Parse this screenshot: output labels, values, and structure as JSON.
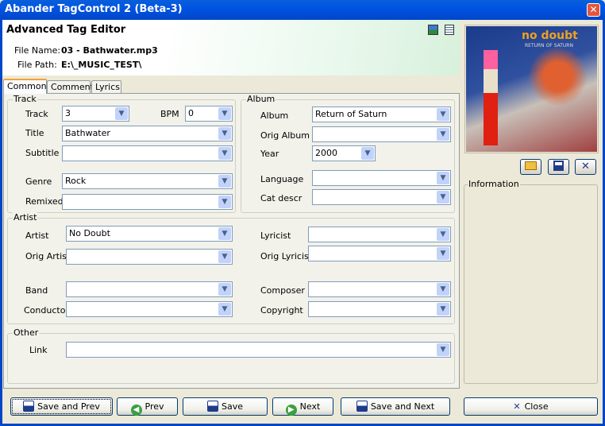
{
  "window": {
    "title": "Abander TagControl 2 (Beta-3)",
    "close": "✕"
  },
  "header": {
    "title": "Advanced Tag Editor",
    "file_name_label": "File Name:",
    "file_name": "03 - Bathwater.mp3",
    "file_path_label": "File Path:",
    "file_path": "E:\\_MUSIC_TEST\\"
  },
  "tabs": [
    {
      "label": "Common",
      "active": true
    },
    {
      "label": "Comment"
    },
    {
      "label": "Lyrics"
    }
  ],
  "track": {
    "group": "Track",
    "track_label": "Track",
    "track": "3",
    "bpm_label": "BPM",
    "bpm": "0",
    "title_label": "Title",
    "title": "Bathwater",
    "subtitle_label": "Subtitle",
    "subtitle": "",
    "genre_label": "Genre",
    "genre": "Rock",
    "remixed_label": "Remixed",
    "remixed": ""
  },
  "album": {
    "group": "Album",
    "album_label": "Album",
    "album": "Return of Saturn",
    "orig_album_label": "Orig Album",
    "orig_album": "",
    "year_label": "Year",
    "year": "2000",
    "language_label": "Language",
    "language": "",
    "cat_descr_label": "Cat descr",
    "cat_descr": ""
  },
  "artist": {
    "group": "Artist",
    "artist_label": "Artist",
    "artist": "No Doubt",
    "orig_artist_label": "Orig Artist",
    "orig_artist": "",
    "band_label": "Band",
    "band": "",
    "conductor_label": "Conductor",
    "conductor": "",
    "lyricist_label": "Lyricist",
    "lyricist": "",
    "orig_lyricist_label": "Orig Lyricist",
    "orig_lyricist": "",
    "composer_label": "Composer",
    "composer": "",
    "copyright_label": "Copyright",
    "copyright": ""
  },
  "other": {
    "group": "Other",
    "link_label": "Link",
    "link": ""
  },
  "cover": {
    "text": "no doubt",
    "subtitle": "RETURN OF SATURN"
  },
  "info": {
    "group": "Information"
  },
  "buttons": {
    "save_prev": "Save and Prev",
    "prev": "Prev",
    "save": "Save",
    "next": "Next",
    "save_next": "Save and Next",
    "close": "Close"
  }
}
